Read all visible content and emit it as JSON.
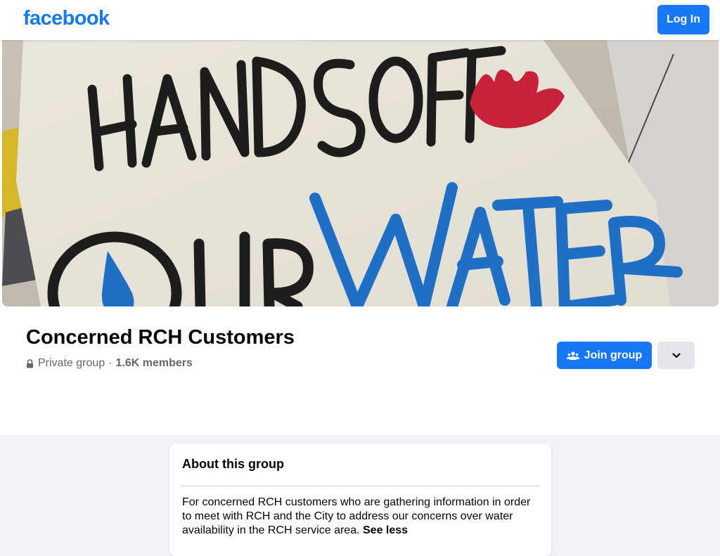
{
  "brand": {
    "logo_text": "facebook",
    "color": "#1877f2"
  },
  "topbar": {
    "login_label": "Log In"
  },
  "cover": {
    "sign_line1": "HANDS OFF",
    "sign_line2": "OUR WATER"
  },
  "group": {
    "name": "Concerned RCH Customers",
    "privacy": "Private group",
    "separator": "·",
    "members": "1.6K members",
    "join_label": "Join group"
  },
  "about": {
    "title": "About this group",
    "description": "For concerned RCH customers who are gathering information in order to meet with RCH and the City to address our concerns over water availability in the RCH service area.",
    "see_less": "See less"
  },
  "colors": {
    "accent": "#1877f2",
    "text_primary": "#050505",
    "text_secondary": "#65676b",
    "page_bg": "#f0f2f5"
  },
  "icons": {
    "privacy": "lock-icon",
    "join": "group-icon",
    "more": "chevron-down-icon"
  }
}
